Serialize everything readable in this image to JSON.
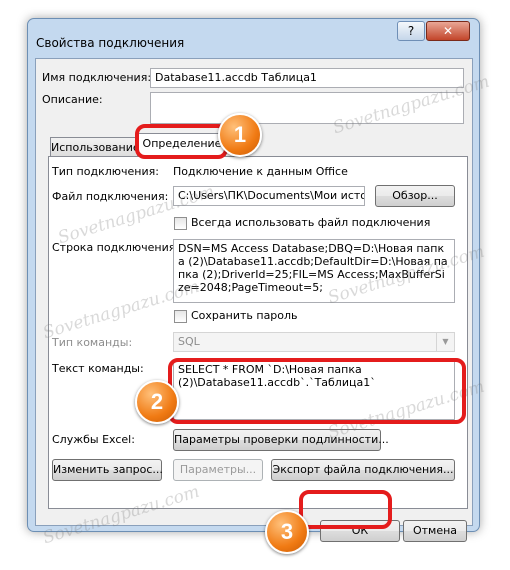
{
  "dialog": {
    "title": "Свойства подключения",
    "help_label": "?",
    "close_label": "✕"
  },
  "connection": {
    "name_label": "Имя подключения:",
    "name_value": "Database11.accdb Таблица1",
    "desc_label": "Описание:",
    "desc_value": ""
  },
  "tabs": [
    {
      "label": "Использование"
    },
    {
      "label": "Определение"
    }
  ],
  "definition": {
    "type_label": "Тип подключения:",
    "type_value": "Подключение к данным Office",
    "file_label": "Файл подключения:",
    "file_value": "C:\\Users\\ПК\\Documents\\Мои источни",
    "browse_label": "Обзор...",
    "always_use_label": "Всегда использовать файл подключения",
    "conn_string_label": "Строка подключения:",
    "conn_string_value": "DSN=MS Access Database;DBQ=D:\\Новая папка (2)\\Database11.accdb;DefaultDir=D:\\Новая папка (2);DriverId=25;FIL=MS Access;MaxBufferSize=2048;PageTimeout=5;",
    "save_password_label": "Сохранить пароль",
    "cmd_type_label": "Тип команды:",
    "cmd_type_value": "SQL",
    "cmd_text_label": "Текст команды:",
    "cmd_text_value": "SELECT * FROM `D:\\Новая папка (2)\\Database11.accdb`.`Таблица1`",
    "excel_services_label": "Службы Excel:",
    "auth_settings_label": "Параметры проверки подлинности...",
    "edit_query_label": "Изменить запрос...",
    "parameters_label": "Параметры...",
    "export_label": "Экспорт файла подключения..."
  },
  "footer": {
    "ok_label": "ОК",
    "cancel_label": "Отмена"
  },
  "annotations": {
    "badge1": "1",
    "badge2": "2",
    "badge3": "3"
  },
  "watermark": "Sovetnagpazu.com",
  "colors": {
    "highlight": "#e41c1c",
    "badge": "#f07a13",
    "frame": "#c4d9ef"
  }
}
